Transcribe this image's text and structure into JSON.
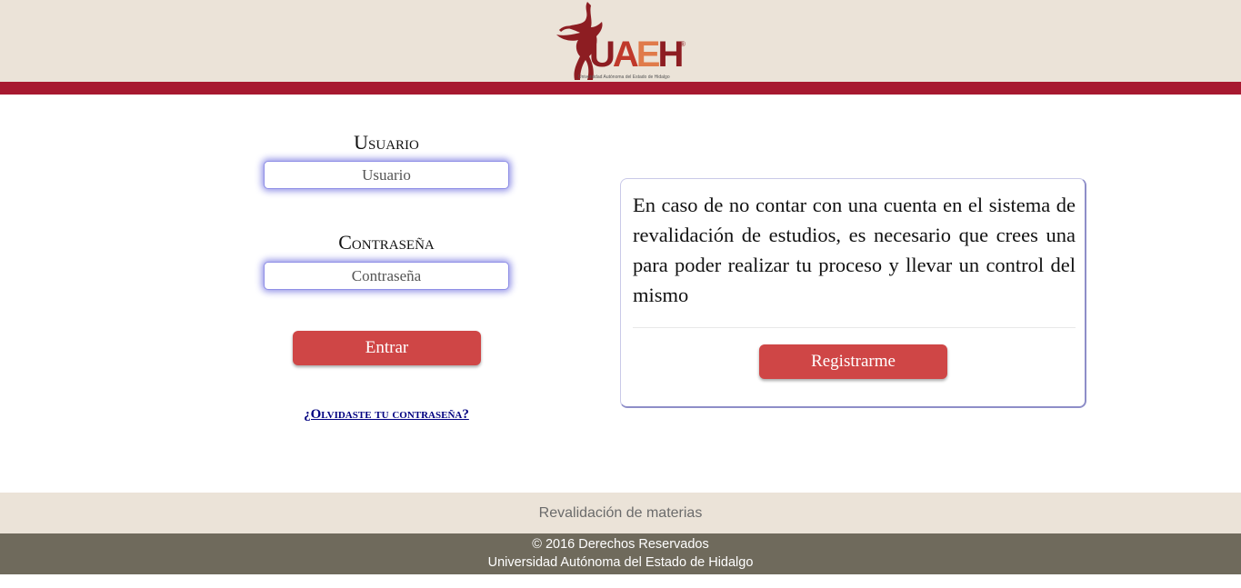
{
  "header": {
    "logo": {
      "wordmark": "UAEH",
      "registered_mark": "®",
      "subtitle": "Universidad Autónoma del Estado de Hidalgo",
      "colors": {
        "dark": "#8d1d22",
        "red": "#c0392b",
        "orange": "#e07b4a"
      }
    },
    "band_color": "#a71930",
    "background_color": "#ebe3d8"
  },
  "login": {
    "user_label": "Usuario",
    "user_placeholder": "Usuario",
    "user_value": "",
    "password_label": "Contraseña",
    "password_placeholder": "Contraseña",
    "password_value": "",
    "submit_label": "Entrar",
    "forgot_link": "¿Olvidaste tu contraseña?"
  },
  "register_panel": {
    "message": "En caso de no contar con una cuenta en el sistema de revalidación de estudios, es necesario que crees una para poder realizar tu proceso y llevar un control del mismo",
    "button_label": "Registrarme"
  },
  "footer": {
    "title": "Revalidación de materias",
    "copyright": "© 2016 Derechos Reservados",
    "institution": "Universidad Autónoma del Estado de Hidalgo"
  },
  "colors": {
    "button": "#cf4646",
    "input_glow": "#8f8fe6",
    "footer_dark": "#6f6a5c"
  }
}
